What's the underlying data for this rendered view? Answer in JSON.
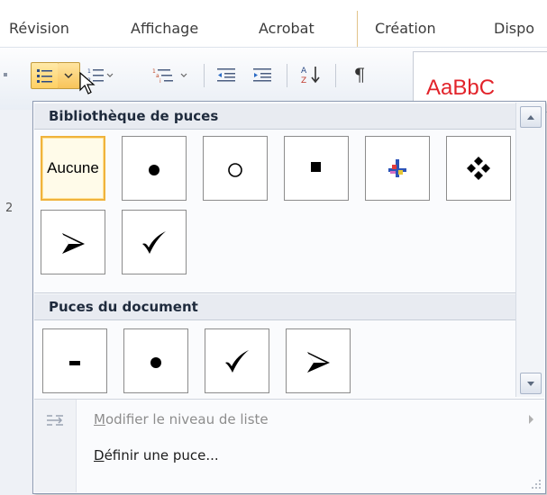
{
  "tabs": [
    "Révision",
    "Affichage",
    "Acrobat",
    "Création",
    "Dispo"
  ],
  "ribbon": {
    "style_preview": "AaBbC",
    "sort_glyph": "A Z",
    "pilcrow": "¶",
    "ruler_number": "2"
  },
  "panel": {
    "library_heading": "Bibliothèque de puces",
    "library_bullets": [
      {
        "label": "Aucune",
        "icon": "none-text",
        "selected": true
      },
      {
        "label": "",
        "icon": "filled-circle-bullet",
        "selected": false
      },
      {
        "label": "",
        "icon": "hollow-circle-bullet",
        "selected": false
      },
      {
        "label": "",
        "icon": "filled-square-bullet",
        "selected": false
      },
      {
        "label": "",
        "icon": "colored-cross-bullet",
        "selected": false
      },
      {
        "label": "",
        "icon": "four-diamond-bullet",
        "selected": false
      },
      {
        "label": "",
        "icon": "arrowhead-bullet",
        "selected": false
      },
      {
        "label": "",
        "icon": "checkmark-bullet",
        "selected": false
      }
    ],
    "document_heading": "Puces du document",
    "document_bullets": [
      "dash-bullet",
      "filled-circle-bullet",
      "checkmark-bullet",
      "arrowhead-bullet"
    ],
    "menu": {
      "change_level_label": "Modifier le niveau de liste",
      "change_level_underline": "M",
      "change_level_rest": "odifier le niveau de liste",
      "change_level_enabled": false,
      "define_label": "Définir une puce...",
      "define_underline": "D",
      "define_rest": "éfinir une puce..."
    }
  },
  "colors": {
    "selected_border": "#f0b33c",
    "style_red": "#e2232a",
    "ribbon_highlight": "#ffd063"
  }
}
